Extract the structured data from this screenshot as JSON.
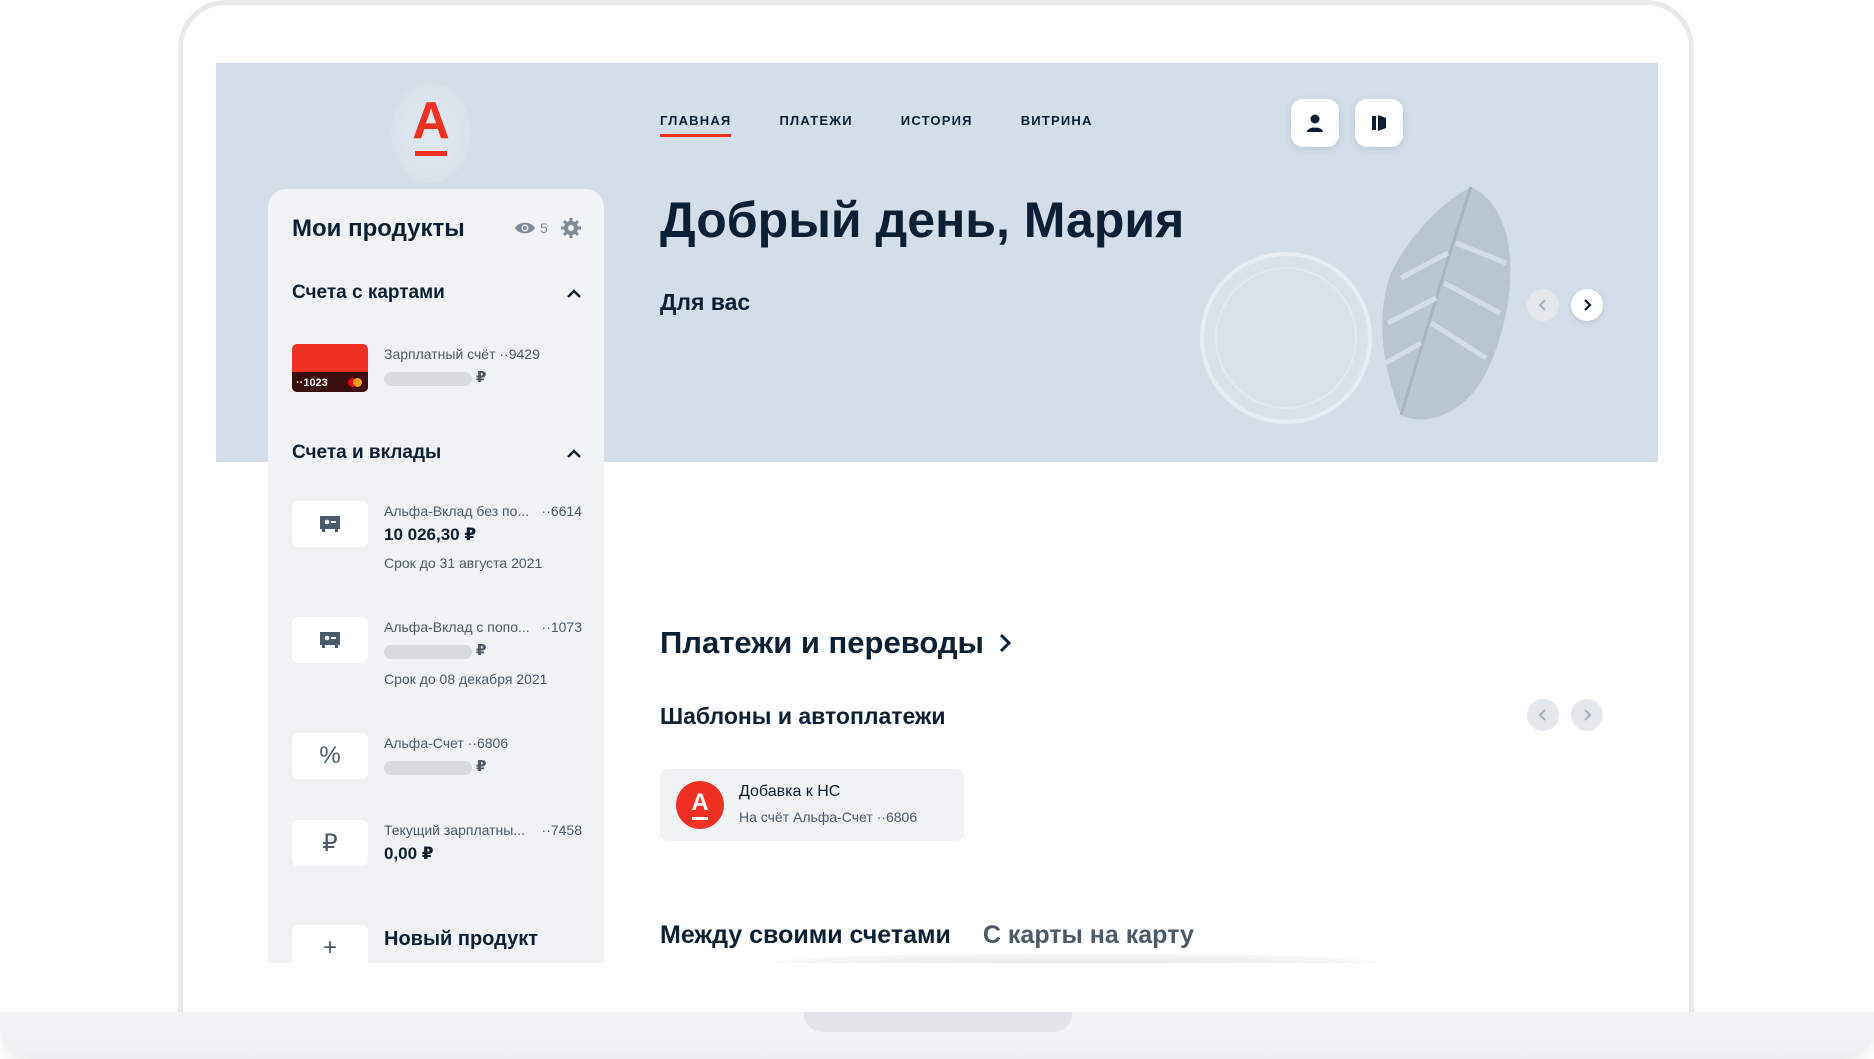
{
  "nav": {
    "items": [
      {
        "label": "ГЛАВНАЯ",
        "active": true
      },
      {
        "label": "ПЛАТЕЖИ",
        "active": false
      },
      {
        "label": "ИСТОРИЯ",
        "active": false
      },
      {
        "label": "ВИТРИНА",
        "active": false
      }
    ]
  },
  "logo": {
    "letter": "А"
  },
  "brand": {
    "accent": "#ef3124",
    "hero_bg": "#d4dee8",
    "text": "#0b1f35"
  },
  "sidebar": {
    "title": "Мои продукты",
    "hidden_count": "5",
    "icons": [
      "eye-icon",
      "gear-icon"
    ],
    "sections": [
      {
        "title": "Счета с картами",
        "items": [
          {
            "name": "Зарплатный счёт ··9429",
            "card_number": "··1023",
            "currency": "₽"
          }
        ]
      },
      {
        "title": "Счета и вклады",
        "items": [
          {
            "name": "Альфа-Вклад без по...",
            "number": "··6614",
            "amount": "10 026,30 ₽",
            "term": "Срок до 31 августа 2021",
            "icon": "deposit-icon"
          },
          {
            "name": "Альфа-Вклад с попо...",
            "number": "··1073",
            "currency": "₽",
            "term": "Срок до 08 декабря 2021",
            "icon": "deposit-icon"
          },
          {
            "name": "Альфа-Счет ··6806",
            "currency": "₽",
            "icon": "percent-icon",
            "glyph": "%"
          },
          {
            "name": "Текущий зарплатны...",
            "number": "··7458",
            "amount": "0,00 ₽",
            "icon": "ruble-icon",
            "glyph": "₽"
          }
        ]
      }
    ],
    "new_product": {
      "label": "Новый продукт",
      "glyph": "+"
    }
  },
  "main": {
    "greeting": "Добрый день, Мария",
    "for_you": "Для вас",
    "payments_title": "Платежи и переводы",
    "templates_title": "Шаблоны и автоплатежи",
    "template_card": {
      "title": "Добавка к НС",
      "subtitle": "На счёт Альфа-Счет ··6806",
      "logo_letter": "А"
    },
    "tabs": [
      "Между своими счетами",
      "С карты на карту"
    ]
  }
}
